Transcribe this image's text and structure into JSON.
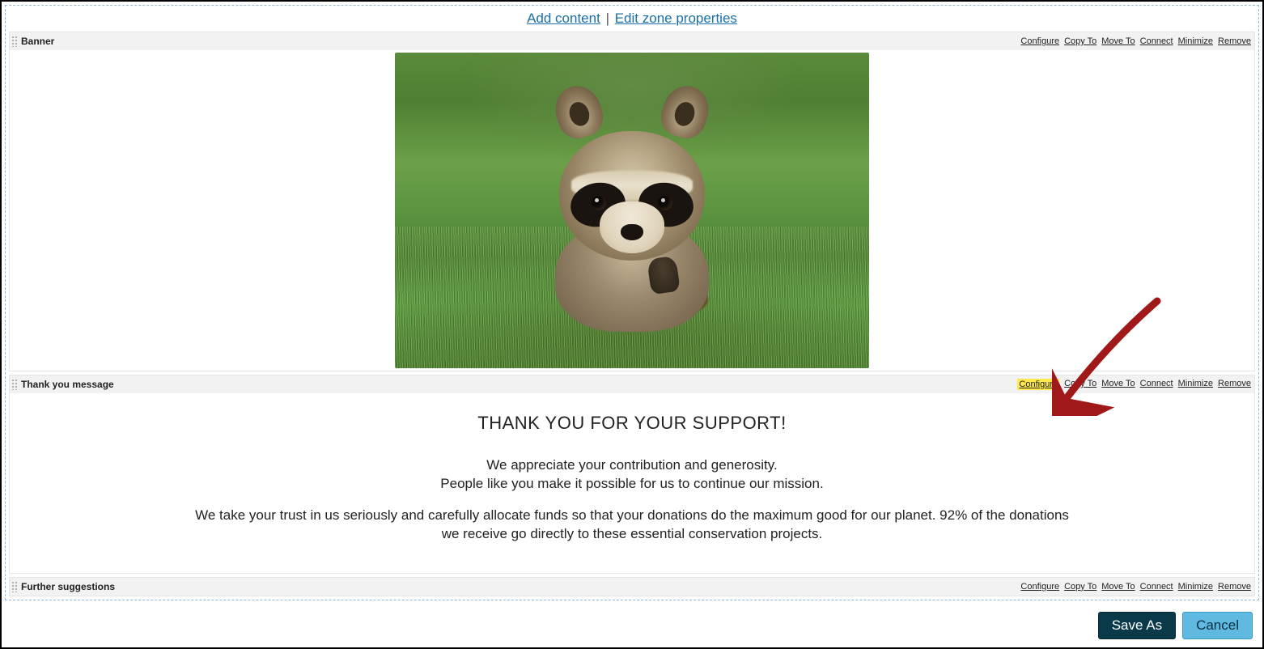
{
  "zoneHeader": {
    "addContent": "Add content",
    "separator": "|",
    "editZone": "Edit zone properties"
  },
  "actions": {
    "configure": "Configure",
    "copyTo": "Copy To",
    "moveTo": "Move To",
    "connect": "Connect",
    "minimize": "Minimize",
    "remove": "Remove"
  },
  "widgets": {
    "banner": {
      "title": "Banner"
    },
    "thankyou": {
      "title": "Thank you message",
      "heading": "THANK YOU FOR YOUR SUPPORT!",
      "line1": "We appreciate your contribution and generosity.",
      "line2": "People like you make it possible for us to continue our mission.",
      "line3": "We take your trust in us seriously and carefully allocate funds so that your donations do the maximum good for our planet. 92% of the donations",
      "line4": "we receive go directly to these essential conservation projects."
    },
    "further": {
      "title": "Further suggestions"
    }
  },
  "buttons": {
    "saveAs": "Save As",
    "cancel": "Cancel"
  }
}
